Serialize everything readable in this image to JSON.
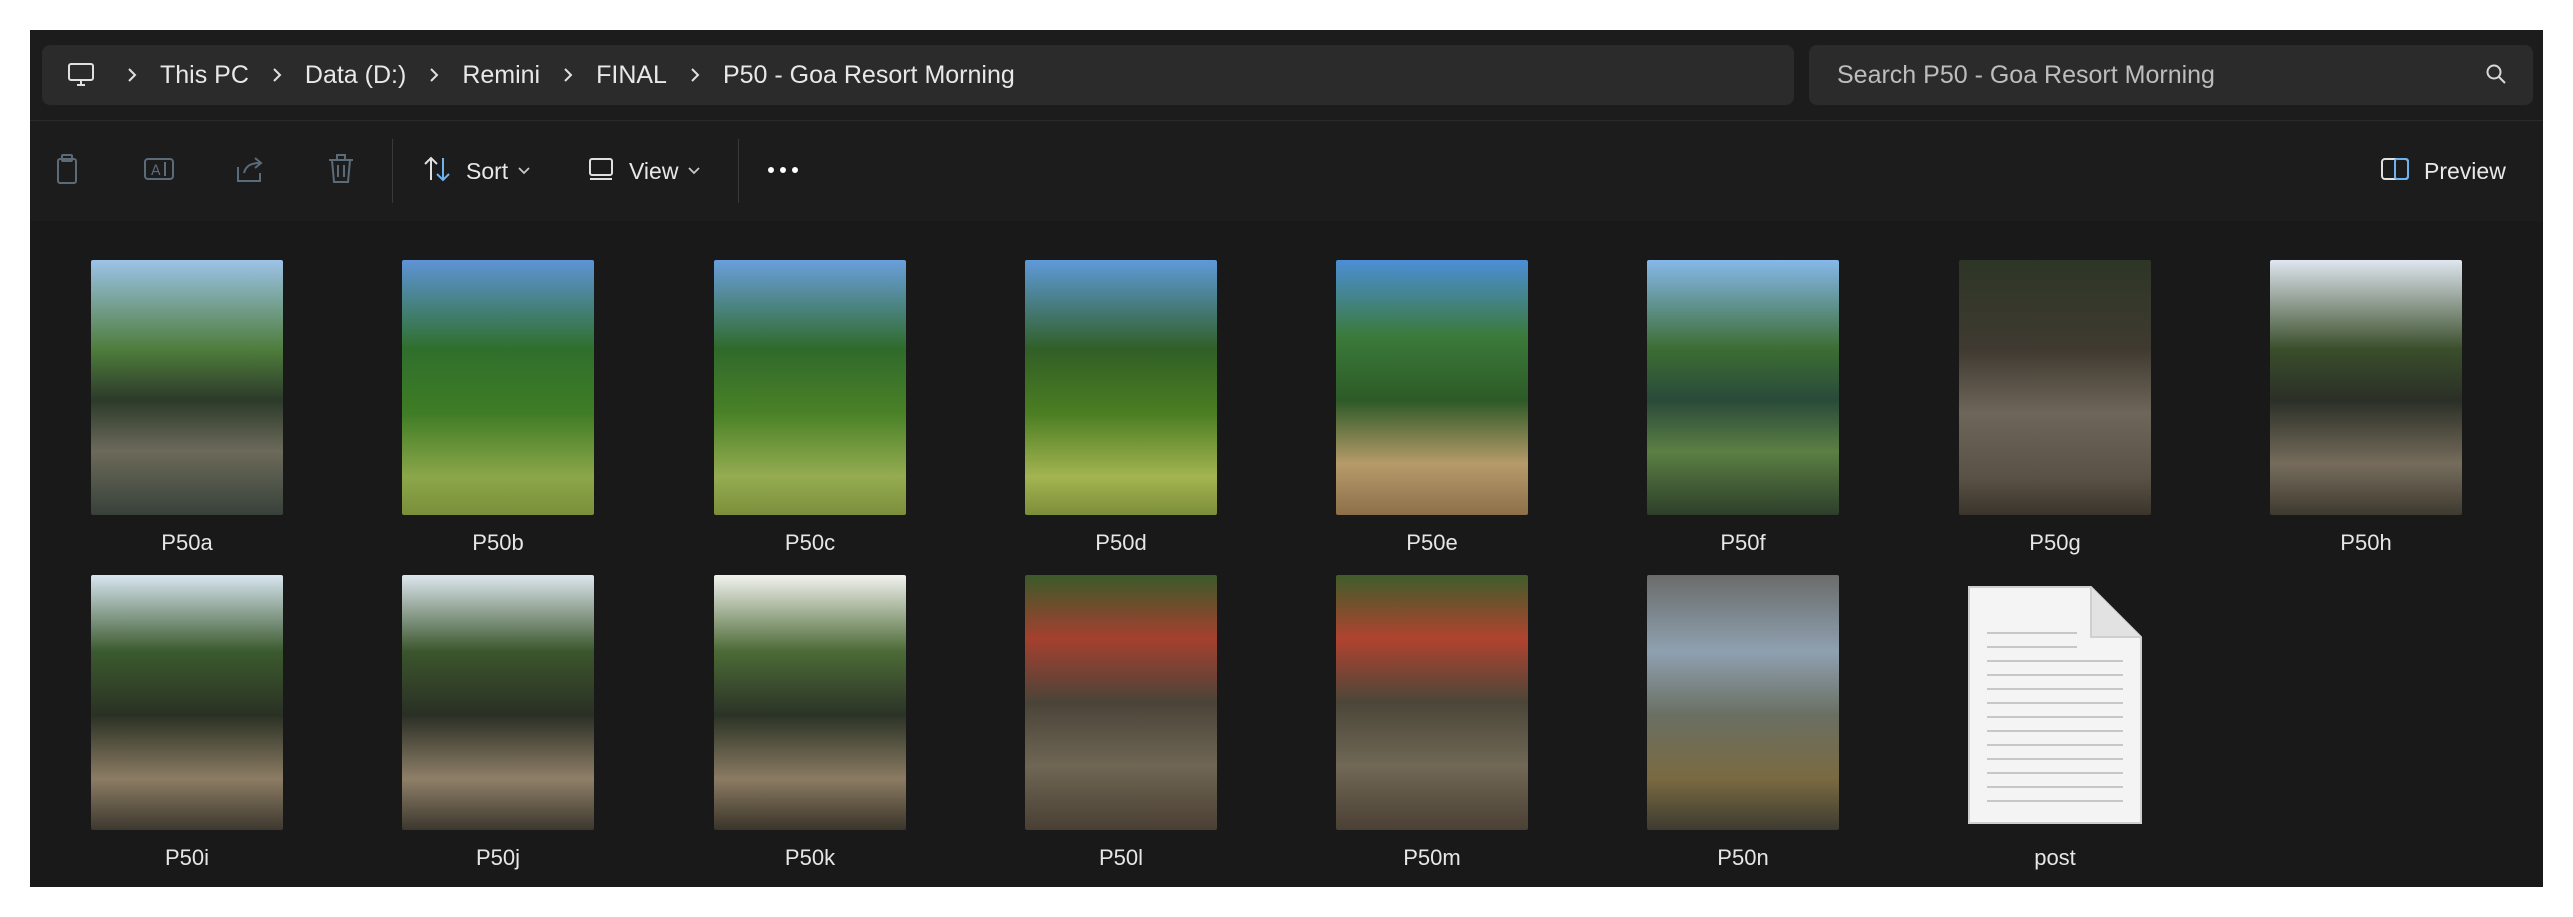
{
  "address_bar": {
    "breadcrumbs": [
      "This PC",
      "Data (D:)",
      "Remini",
      "FINAL",
      "P50 - Goa Resort Morning"
    ]
  },
  "search": {
    "placeholder": "Search P50 - Goa Resort Morning"
  },
  "toolbar": {
    "sort_label": "Sort",
    "view_label": "View",
    "more_label": "•••",
    "preview_label": "Preview"
  },
  "files": [
    {
      "name": "P50a",
      "type": "image"
    },
    {
      "name": "P50b",
      "type": "image"
    },
    {
      "name": "P50c",
      "type": "image"
    },
    {
      "name": "P50d",
      "type": "image"
    },
    {
      "name": "P50e",
      "type": "image"
    },
    {
      "name": "P50f",
      "type": "image"
    },
    {
      "name": "P50g",
      "type": "image"
    },
    {
      "name": "P50h",
      "type": "image"
    },
    {
      "name": "P50i",
      "type": "image"
    },
    {
      "name": "P50j",
      "type": "image"
    },
    {
      "name": "P50k",
      "type": "image"
    },
    {
      "name": "P50l",
      "type": "image"
    },
    {
      "name": "P50m",
      "type": "image"
    },
    {
      "name": "P50n",
      "type": "image"
    },
    {
      "name": "post",
      "type": "text-document"
    }
  ],
  "icons": [
    "computer-icon",
    "chevron-right-icon",
    "search-icon",
    "copy-icon",
    "rename-icon",
    "share-icon",
    "delete-icon",
    "sort-icon",
    "view-icon",
    "chevron-down-icon",
    "more-icon",
    "preview-pane-icon",
    "document-icon"
  ]
}
